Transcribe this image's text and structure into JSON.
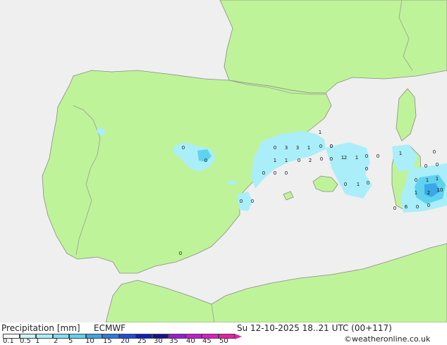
{
  "colors": {
    "sea": "#efefef",
    "land": "#bff399",
    "border": "#9a9a9a",
    "coast": "#8a8a8a",
    "precip_light": "#aaeefa",
    "precip_mid": "#5fd2f0",
    "precip_strong": "#3aa8e8"
  },
  "footer": {
    "title": "Precipitation [mm]",
    "model": "ECMWF",
    "datetime": "Su 12-10-2025 18..21 UTC (00+117)",
    "credit": "©weatheronline.co.uk"
  },
  "legend": {
    "ticks": [
      "0.1",
      "0.5",
      "1",
      "2",
      "5",
      "10",
      "15",
      "20",
      "25",
      "30",
      "35",
      "40",
      "45",
      "50"
    ],
    "colors": [
      "#ffffff",
      "#c8f6fb",
      "#aaeefa",
      "#7fe0f6",
      "#5fd2f0",
      "#3aa8e8",
      "#2a7ce0",
      "#1c4fd6",
      "#0c22b8",
      "#1a1090",
      "#9b1ad8",
      "#c61ad8",
      "#e01ac8",
      "#f01aa8"
    ]
  },
  "labels": [
    {
      "text": "0"
    },
    {
      "text": "0"
    },
    {
      "text": "3"
    },
    {
      "text": "3"
    },
    {
      "text": "1"
    },
    {
      "text": "0"
    },
    {
      "text": "0"
    },
    {
      "text": "1"
    },
    {
      "text": "1"
    },
    {
      "text": "0"
    },
    {
      "text": "2"
    },
    {
      "text": "0"
    },
    {
      "text": "0"
    },
    {
      "text": "1"
    },
    {
      "text": "2"
    },
    {
      "text": "1"
    },
    {
      "text": "0"
    },
    {
      "text": "0"
    },
    {
      "text": "0"
    },
    {
      "text": "0"
    },
    {
      "text": "0"
    },
    {
      "text": "0"
    },
    {
      "text": "1"
    },
    {
      "text": "0"
    },
    {
      "text": "0"
    },
    {
      "text": "0"
    },
    {
      "text": "0"
    },
    {
      "text": "0"
    },
    {
      "text": "0"
    },
    {
      "text": "1"
    },
    {
      "text": "0"
    },
    {
      "text": "0"
    },
    {
      "text": "1"
    },
    {
      "text": "0"
    },
    {
      "text": "1"
    },
    {
      "text": "1"
    },
    {
      "text": "2"
    },
    {
      "text": "10"
    },
    {
      "text": "6"
    },
    {
      "text": "0"
    },
    {
      "text": "0"
    },
    {
      "text": "0"
    },
    {
      "text": "1"
    },
    {
      "text": "0"
    },
    {
      "text": "0"
    }
  ]
}
